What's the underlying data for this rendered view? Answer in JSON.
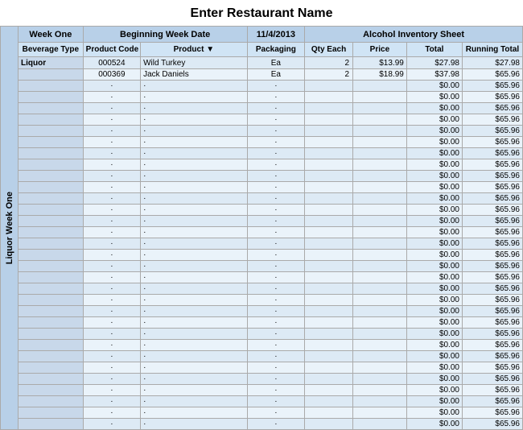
{
  "page": {
    "title": "Enter Restaurant Name",
    "header": {
      "week_label": "Week One",
      "beg_week_label": "Beginning Week Date",
      "date": "11/4/2013",
      "sheet_label": "Alcohol Inventory Sheet"
    },
    "columns": [
      "Beverage Type",
      "Product Code",
      "Product",
      "Packaging",
      "Qty Each",
      "Price",
      "Total",
      "Running Total"
    ],
    "side_label": "Liquor Week One",
    "rows": [
      {
        "bev": "Liquor",
        "code": "000524",
        "product": "Wild Turkey",
        "pack": "Ea",
        "qty": "2",
        "price": "$13.99",
        "total": "$27.98",
        "running": "$27.98"
      },
      {
        "bev": "",
        "code": "000369",
        "product": "Jack Daniels",
        "pack": "Ea",
        "qty": "2",
        "price": "$18.99",
        "total": "$37.98",
        "running": "$65.96"
      },
      {
        "bev": "",
        "code": "·",
        "product": "·",
        "pack": "·",
        "qty": "",
        "price": "",
        "total": "$0.00",
        "running": "$65.96"
      },
      {
        "bev": "",
        "code": "·",
        "product": "·",
        "pack": "·",
        "qty": "",
        "price": "",
        "total": "$0.00",
        "running": "$65.96"
      },
      {
        "bev": "",
        "code": "·",
        "product": "·",
        "pack": "·",
        "qty": "",
        "price": "",
        "total": "$0.00",
        "running": "$65.96"
      },
      {
        "bev": "",
        "code": "·",
        "product": "·",
        "pack": "·",
        "qty": "",
        "price": "",
        "total": "$0.00",
        "running": "$65.96"
      },
      {
        "bev": "",
        "code": "·",
        "product": "·",
        "pack": "·",
        "qty": "",
        "price": "",
        "total": "$0.00",
        "running": "$65.96"
      },
      {
        "bev": "",
        "code": "·",
        "product": "·",
        "pack": "·",
        "qty": "",
        "price": "",
        "total": "$0.00",
        "running": "$65.96"
      },
      {
        "bev": "",
        "code": "·",
        "product": "·",
        "pack": "·",
        "qty": "",
        "price": "",
        "total": "$0.00",
        "running": "$65.96"
      },
      {
        "bev": "",
        "code": "·",
        "product": "·",
        "pack": "·",
        "qty": "",
        "price": "",
        "total": "$0.00",
        "running": "$65.96"
      },
      {
        "bev": "",
        "code": "·",
        "product": "·",
        "pack": "·",
        "qty": "",
        "price": "",
        "total": "$0.00",
        "running": "$65.96"
      },
      {
        "bev": "",
        "code": "·",
        "product": "·",
        "pack": "·",
        "qty": "",
        "price": "",
        "total": "$0.00",
        "running": "$65.96"
      },
      {
        "bev": "",
        "code": "·",
        "product": "·",
        "pack": "·",
        "qty": "",
        "price": "",
        "total": "$0.00",
        "running": "$65.96"
      },
      {
        "bev": "",
        "code": "·",
        "product": "·",
        "pack": "·",
        "qty": "",
        "price": "",
        "total": "$0.00",
        "running": "$65.96"
      },
      {
        "bev": "",
        "code": "·",
        "product": "·",
        "pack": "·",
        "qty": "",
        "price": "",
        "total": "$0.00",
        "running": "$65.96"
      },
      {
        "bev": "",
        "code": "·",
        "product": "·",
        "pack": "·",
        "qty": "",
        "price": "",
        "total": "$0.00",
        "running": "$65.96"
      },
      {
        "bev": "",
        "code": "·",
        "product": "·",
        "pack": "·",
        "qty": "",
        "price": "",
        "total": "$0.00",
        "running": "$65.96"
      },
      {
        "bev": "",
        "code": "·",
        "product": "·",
        "pack": "·",
        "qty": "",
        "price": "",
        "total": "$0.00",
        "running": "$65.96"
      },
      {
        "bev": "",
        "code": "·",
        "product": "·",
        "pack": "·",
        "qty": "",
        "price": "",
        "total": "$0.00",
        "running": "$65.96"
      },
      {
        "bev": "",
        "code": "·",
        "product": "·",
        "pack": "·",
        "qty": "",
        "price": "",
        "total": "$0.00",
        "running": "$65.96"
      },
      {
        "bev": "",
        "code": "·",
        "product": "·",
        "pack": "·",
        "qty": "",
        "price": "",
        "total": "$0.00",
        "running": "$65.96"
      },
      {
        "bev": "",
        "code": "·",
        "product": "·",
        "pack": "·",
        "qty": "",
        "price": "",
        "total": "$0.00",
        "running": "$65.96"
      },
      {
        "bev": "",
        "code": "·",
        "product": "·",
        "pack": "·",
        "qty": "",
        "price": "",
        "total": "$0.00",
        "running": "$65.96"
      },
      {
        "bev": "",
        "code": "·",
        "product": "·",
        "pack": "·",
        "qty": "",
        "price": "",
        "total": "$0.00",
        "running": "$65.96"
      },
      {
        "bev": "",
        "code": "·",
        "product": "·",
        "pack": "·",
        "qty": "",
        "price": "",
        "total": "$0.00",
        "running": "$65.96"
      },
      {
        "bev": "",
        "code": "·",
        "product": "·",
        "pack": "·",
        "qty": "",
        "price": "",
        "total": "$0.00",
        "running": "$65.96"
      },
      {
        "bev": "",
        "code": "·",
        "product": "·",
        "pack": "·",
        "qty": "",
        "price": "",
        "total": "$0.00",
        "running": "$65.96"
      },
      {
        "bev": "",
        "code": "·",
        "product": "·",
        "pack": "·",
        "qty": "",
        "price": "",
        "total": "$0.00",
        "running": "$65.96"
      },
      {
        "bev": "",
        "code": "·",
        "product": "·",
        "pack": "·",
        "qty": "",
        "price": "",
        "total": "$0.00",
        "running": "$65.96"
      },
      {
        "bev": "",
        "code": "·",
        "product": "·",
        "pack": "·",
        "qty": "",
        "price": "",
        "total": "$0.00",
        "running": "$65.96"
      },
      {
        "bev": "",
        "code": "·",
        "product": "·",
        "pack": "·",
        "qty": "",
        "price": "",
        "total": "$0.00",
        "running": "$65.96"
      },
      {
        "bev": "",
        "code": "·",
        "product": "·",
        "pack": "·",
        "qty": "",
        "price": "",
        "total": "$0.00",
        "running": "$65.96"
      },
      {
        "bev": "",
        "code": "·",
        "product": "·",
        "pack": "·",
        "qty": "",
        "price": "",
        "total": "$0.00",
        "running": "$65.96"
      }
    ]
  }
}
